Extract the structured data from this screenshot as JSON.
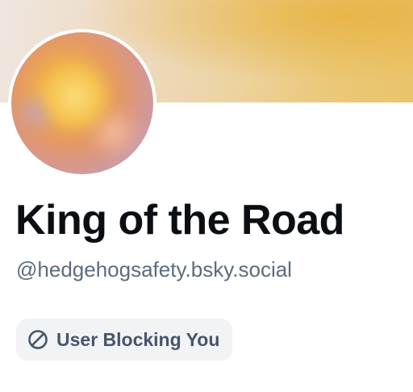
{
  "profile": {
    "display_name": "King of the Road",
    "handle": "@hedgehogsafety.bsky.social",
    "block_status": {
      "label": "User Blocking You",
      "icon": "blocked-circle-icon"
    }
  },
  "colors": {
    "banner_accent": "#EAC46A",
    "handle_text": "#5C6B7F",
    "pill_background": "#F1F3F5",
    "pill_text": "#46556A"
  }
}
